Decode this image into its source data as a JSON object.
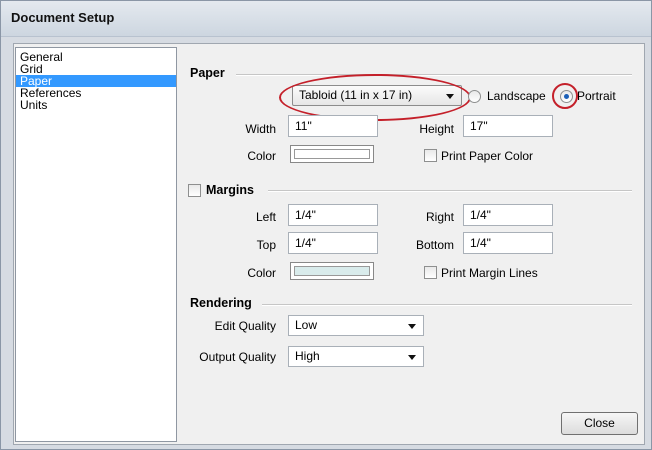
{
  "window": {
    "title": "Document Setup"
  },
  "sidebar": {
    "items": [
      "General",
      "Grid",
      "Paper",
      "References",
      "Units"
    ],
    "selected_index": 2
  },
  "paper": {
    "heading": "Paper",
    "size_value": "Tabloid (11 in x 17 in)",
    "orientation": {
      "landscape_label": "Landscape",
      "portrait_label": "Portrait",
      "selected": "Portrait"
    },
    "width_label": "Width",
    "width_value": "11\"",
    "height_label": "Height",
    "height_value": "17\"",
    "color_label": "Color",
    "color_value": "#ffffff",
    "print_color_label": "Print Paper Color",
    "print_color_checked": false
  },
  "margins": {
    "heading": "Margins",
    "enabled": false,
    "left_label": "Left",
    "left_value": "1/4\"",
    "right_label": "Right",
    "right_value": "1/4\"",
    "top_label": "Top",
    "top_value": "1/4\"",
    "bottom_label": "Bottom",
    "bottom_value": "1/4\"",
    "color_label": "Color",
    "color_value": "#d9ecec",
    "print_lines_label": "Print Margin Lines",
    "print_lines_checked": false
  },
  "rendering": {
    "heading": "Rendering",
    "edit_quality_label": "Edit Quality",
    "edit_quality_value": "Low",
    "output_quality_label": "Output Quality",
    "output_quality_value": "High"
  },
  "footer": {
    "close_label": "Close"
  },
  "annotation_color": "#c4202a"
}
